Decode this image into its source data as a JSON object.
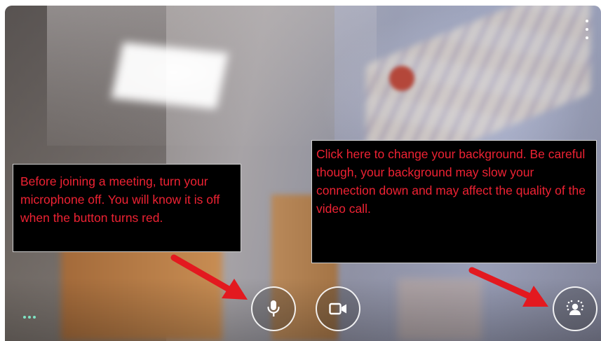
{
  "preview": {
    "more_options_icon": "vertical-dots-icon",
    "overflow_icon": "horizontal-dots-icon"
  },
  "controls": {
    "mic_icon": "microphone-icon",
    "camera_icon": "video-camera-icon",
    "background_icon": "background-effects-icon"
  },
  "callouts": {
    "mic": "Before joining a meeting, turn your microphone off. You will know it is off when the button turns red.",
    "background": "Click here to change your background. Be careful though, your background may slow your connection down and may affect the quality of the video call."
  },
  "colors": {
    "callout_text": "#ee2233",
    "callout_bg": "#000000",
    "arrow": "#e3191f",
    "dots_accent": "#7fe3c4"
  }
}
